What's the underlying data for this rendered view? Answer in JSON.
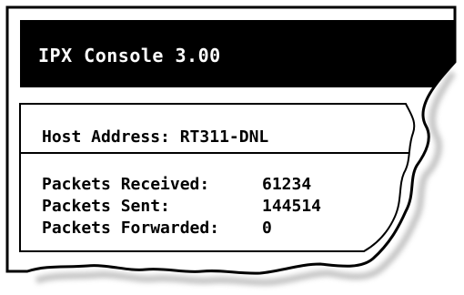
{
  "window": {
    "title": "IPX Console 3.00",
    "colors": {
      "title_bg": "#000000",
      "title_text": "#ffffff",
      "panel_bg": "#ffffff",
      "text": "#000000"
    }
  },
  "host": {
    "label": "Host Address: ",
    "value": "RT311-DNL"
  },
  "stats": [
    {
      "label": "Packets Received:",
      "value": "61234"
    },
    {
      "label": "Packets Sent:",
      "value": "144514"
    },
    {
      "label": "Packets Forwarded:",
      "value": "0"
    }
  ]
}
